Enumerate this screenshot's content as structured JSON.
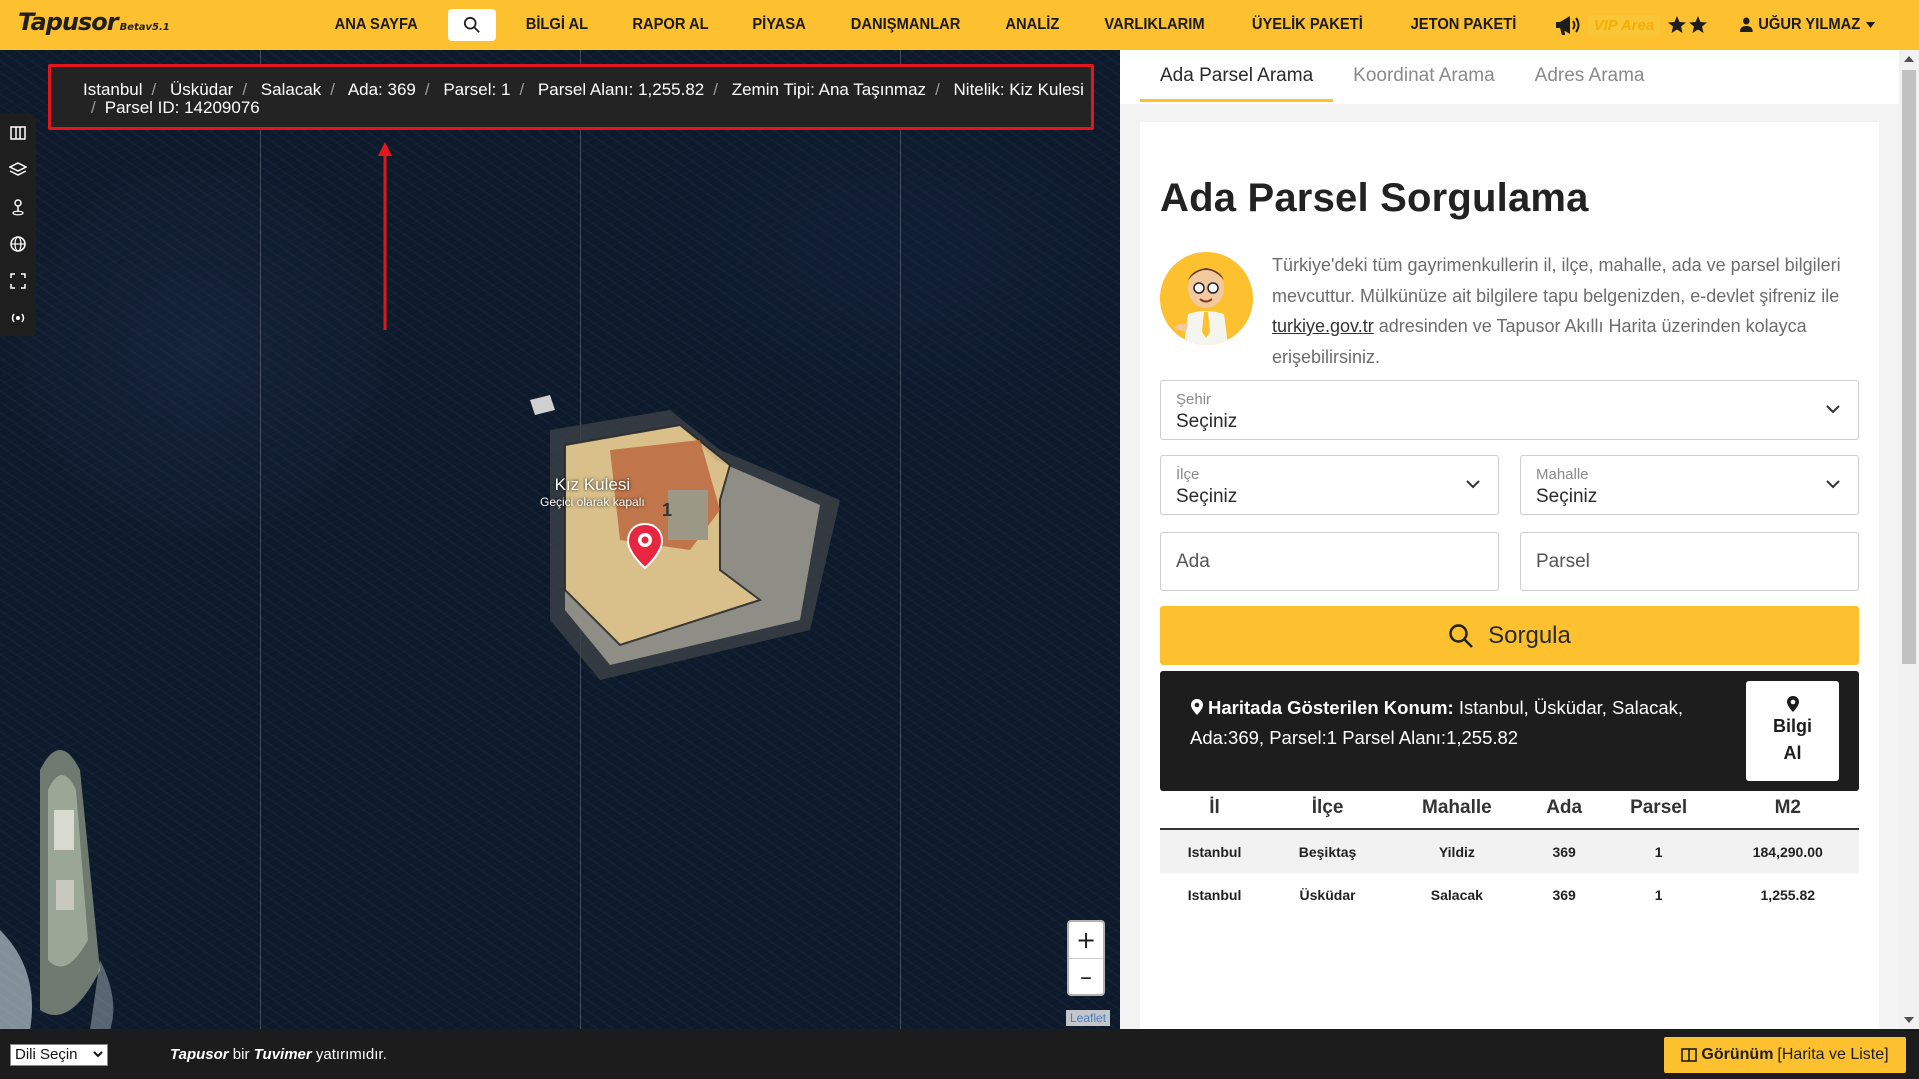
{
  "header": {
    "logo": "Tapusor",
    "logo_version": "Betav5.1",
    "nav": [
      "ANA SAYFA",
      "BİLGİ AL",
      "RAPOR AL",
      "PİYASA",
      "DANIŞMANLAR",
      "ANALİZ",
      "VARLIKLARIM",
      "ÜYELİK PAKETİ",
      "JETON PAKETİ"
    ],
    "vip_label": "VIP Area",
    "user_name": "UĞUR YILMAZ"
  },
  "map": {
    "breadcrumb": [
      "Istanbul",
      "Üsküdar",
      "Salacak",
      "Ada: 369",
      "Parsel: 1",
      "Parsel Alanı: 1,255.82",
      "Zemin Tipi: Ana Taşınmaz",
      "Nitelik: Kiz Kulesi"
    ],
    "breadcrumb_line2": "Parsel ID: 14209076",
    "poi_name": "Kız Kulesi",
    "poi_status": "Geçici olarak kapalı",
    "parcel_number": "1",
    "zoom_in": "+",
    "zoom_out": "–",
    "attribution": "Leaflet"
  },
  "tabs": [
    {
      "label": "Ada Parsel Arama",
      "active": true
    },
    {
      "label": "Koordinat Arama",
      "active": false
    },
    {
      "label": "Adres Arama",
      "active": false
    }
  ],
  "form": {
    "title": "Ada Parsel Sorgulama",
    "intro_before_link": "Türkiye'deki tüm gayrimenkullerin il, ilçe, mahalle, ada ve parsel bilgileri mevcuttur. Mülkünüze ait bilgilere tapu belgenizden, e-devlet şifreniz ile ",
    "intro_link": "turkiye.gov.tr",
    "intro_after_link": " adresinden ve Tapusor Akıllı Harita üzerinden kolayca erişebilirsiniz.",
    "sehir": {
      "label": "Şehir",
      "value": "Seçiniz"
    },
    "ilce": {
      "label": "İlçe",
      "value": "Seçiniz"
    },
    "mahalle": {
      "label": "Mahalle",
      "value": "Seçiniz"
    },
    "ada_placeholder": "Ada",
    "parsel_placeholder": "Parsel",
    "submit_label": "Sorgula"
  },
  "location": {
    "label": "Haritada Gösterilen Konum:",
    "value": " Istanbul, Üsküdar, Salacak, Ada:369, Parsel:1 Parsel Alanı:1,255.82",
    "button_line1": "Bilgi",
    "button_line2": "Al"
  },
  "results": {
    "columns": [
      "İl",
      "İlçe",
      "Mahalle",
      "Ada",
      "Parsel",
      "M2"
    ],
    "rows": [
      [
        "Istanbul",
        "Beşiktaş",
        "Yildiz",
        "369",
        "1",
        "184,290.00"
      ],
      [
        "Istanbul",
        "Üsküdar",
        "Salacak",
        "369",
        "1",
        "1,255.82"
      ]
    ]
  },
  "footer": {
    "language_label": "Dili Seçin",
    "brand": "Tapusor",
    "brand_mid": "bir",
    "brand_parent": "Tuvimer",
    "brand_suffix": "yatırımıdır.",
    "view_label": "Görünüm",
    "view_options": "[Harita ve Liste]"
  },
  "colors": {
    "accent": "#fdc02f",
    "highlight": "#e4151b",
    "dark": "#1d1d1d"
  }
}
